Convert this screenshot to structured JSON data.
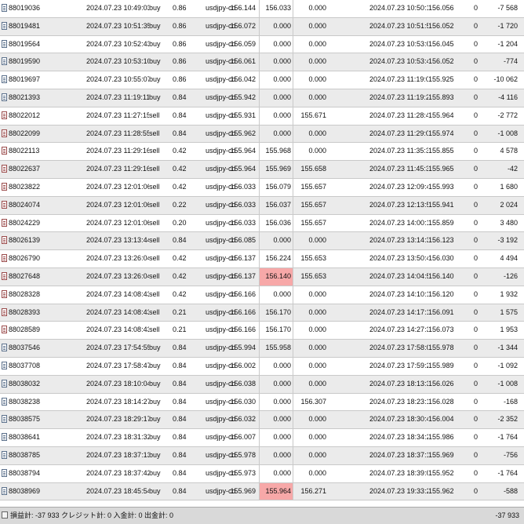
{
  "rows": [
    {
      "ticket": "88019036",
      "open_time": "2024.07.23 10:49:03",
      "type": "buy",
      "volume": "0.86",
      "symbol": "usdjpy-cd",
      "open_price": "156.144",
      "sl": "156.033",
      "tp": "0.000",
      "close_time": "2024.07.23 10:50:17",
      "close_price": "156.056",
      "commission": "0",
      "profit": "-7 568",
      "highlight_sl": false
    },
    {
      "ticket": "88019481",
      "open_time": "2024.07.23 10:51:35",
      "type": "buy",
      "volume": "0.86",
      "symbol": "usdjpy-cd",
      "open_price": "156.072",
      "sl": "0.000",
      "tp": "0.000",
      "close_time": "2024.07.23 10:51:50",
      "close_price": "156.052",
      "commission": "0",
      "profit": "-1 720",
      "highlight_sl": false
    },
    {
      "ticket": "88019564",
      "open_time": "2024.07.23 10:52:43",
      "type": "buy",
      "volume": "0.86",
      "symbol": "usdjpy-cd",
      "open_price": "156.059",
      "sl": "0.000",
      "tp": "0.000",
      "close_time": "2024.07.23 10:53:02",
      "close_price": "156.045",
      "commission": "0",
      "profit": "-1 204",
      "highlight_sl": false
    },
    {
      "ticket": "88019590",
      "open_time": "2024.07.23 10:53:10",
      "type": "buy",
      "volume": "0.86",
      "symbol": "usdjpy-cd",
      "open_price": "156.061",
      "sl": "0.000",
      "tp": "0.000",
      "close_time": "2024.07.23 10:53:45",
      "close_price": "156.052",
      "commission": "0",
      "profit": "-774",
      "highlight_sl": false
    },
    {
      "ticket": "88019697",
      "open_time": "2024.07.23 10:55:07",
      "type": "buy",
      "volume": "0.86",
      "symbol": "usdjpy-cd",
      "open_price": "156.042",
      "sl": "0.000",
      "tp": "0.000",
      "close_time": "2024.07.23 11:19:01",
      "close_price": "155.925",
      "commission": "0",
      "profit": "-10 062",
      "highlight_sl": false
    },
    {
      "ticket": "88021393",
      "open_time": "2024.07.23 11:19:11",
      "type": "buy",
      "volume": "0.84",
      "symbol": "usdjpy-cd",
      "open_price": "155.942",
      "sl": "0.000",
      "tp": "0.000",
      "close_time": "2024.07.23 11:19:27",
      "close_price": "155.893",
      "commission": "0",
      "profit": "-4 116",
      "highlight_sl": false
    },
    {
      "ticket": "88022012",
      "open_time": "2024.07.23 11:27:15",
      "type": "sell",
      "volume": "0.84",
      "symbol": "usdjpy-cd",
      "open_price": "155.931",
      "sl": "0.000",
      "tp": "155.671",
      "close_time": "2024.07.23 11:28:49",
      "close_price": "155.964",
      "commission": "0",
      "profit": "-2 772",
      "highlight_sl": false
    },
    {
      "ticket": "88022099",
      "open_time": "2024.07.23 11:28:55",
      "type": "sell",
      "volume": "0.84",
      "symbol": "usdjpy-cd",
      "open_price": "155.962",
      "sl": "0.000",
      "tp": "0.000",
      "close_time": "2024.07.23 11:29:09",
      "close_price": "155.974",
      "commission": "0",
      "profit": "-1 008",
      "highlight_sl": false
    },
    {
      "ticket": "88022113",
      "open_time": "2024.07.23 11:29:16",
      "type": "sell",
      "volume": "0.42",
      "symbol": "usdjpy-cd",
      "open_price": "155.964",
      "sl": "155.968",
      "tp": "0.000",
      "close_time": "2024.07.23 11:35:38",
      "close_price": "155.855",
      "commission": "0",
      "profit": "4 578",
      "highlight_sl": false
    },
    {
      "ticket": "88022637",
      "open_time": "2024.07.23 11:29:16",
      "type": "sell",
      "volume": "0.42",
      "symbol": "usdjpy-cd",
      "open_price": "155.964",
      "sl": "155.969",
      "tp": "155.658",
      "close_time": "2024.07.23 11:45:37",
      "close_price": "155.965",
      "commission": "0",
      "profit": "-42",
      "highlight_sl": false
    },
    {
      "ticket": "88023822",
      "open_time": "2024.07.23 12:01:06",
      "type": "sell",
      "volume": "0.42",
      "symbol": "usdjpy-cd",
      "open_price": "156.033",
      "sl": "156.079",
      "tp": "155.657",
      "close_time": "2024.07.23 12:09:46",
      "close_price": "155.993",
      "commission": "0",
      "profit": "1 680",
      "highlight_sl": false
    },
    {
      "ticket": "88024074",
      "open_time": "2024.07.23 12:01:06",
      "type": "sell",
      "volume": "0.22",
      "symbol": "usdjpy-cd",
      "open_price": "156.033",
      "sl": "156.037",
      "tp": "155.657",
      "close_time": "2024.07.23 12:13:52",
      "close_price": "155.941",
      "commission": "0",
      "profit": "2 024",
      "highlight_sl": false
    },
    {
      "ticket": "88024229",
      "open_time": "2024.07.23 12:01:06",
      "type": "sell",
      "volume": "0.20",
      "symbol": "usdjpy-cd",
      "open_price": "156.033",
      "sl": "156.036",
      "tp": "155.657",
      "close_time": "2024.07.23 14:00:12",
      "close_price": "155.859",
      "commission": "0",
      "profit": "3 480",
      "highlight_sl": false
    },
    {
      "ticket": "88026139",
      "open_time": "2024.07.23 13:13:44",
      "type": "sell",
      "volume": "0.84",
      "symbol": "usdjpy-cd",
      "open_price": "156.085",
      "sl": "0.000",
      "tp": "0.000",
      "close_time": "2024.07.23 13:14:33",
      "close_price": "156.123",
      "commission": "0",
      "profit": "-3 192",
      "highlight_sl": false
    },
    {
      "ticket": "88026790",
      "open_time": "2024.07.23 13:26:04",
      "type": "sell",
      "volume": "0.42",
      "symbol": "usdjpy-cd",
      "open_price": "156.137",
      "sl": "156.224",
      "tp": "155.653",
      "close_time": "2024.07.23 13:50:46",
      "close_price": "156.030",
      "commission": "0",
      "profit": "4 494",
      "highlight_sl": false
    },
    {
      "ticket": "88027648",
      "open_time": "2024.07.23 13:26:04",
      "type": "sell",
      "volume": "0.42",
      "symbol": "usdjpy-cd",
      "open_price": "156.137",
      "sl": "156.140",
      "tp": "155.653",
      "close_time": "2024.07.23 14:04:50",
      "close_price": "156.140",
      "commission": "0",
      "profit": "-126",
      "highlight_sl": true
    },
    {
      "ticket": "88028328",
      "open_time": "2024.07.23 14:08:43",
      "type": "sell",
      "volume": "0.42",
      "symbol": "usdjpy-cd",
      "open_price": "156.166",
      "sl": "0.000",
      "tp": "0.000",
      "close_time": "2024.07.23 14:10:17",
      "close_price": "156.120",
      "commission": "0",
      "profit": "1 932",
      "highlight_sl": false
    },
    {
      "ticket": "88028393",
      "open_time": "2024.07.23 14:08:43",
      "type": "sell",
      "volume": "0.21",
      "symbol": "usdjpy-cd",
      "open_price": "156.166",
      "sl": "156.170",
      "tp": "0.000",
      "close_time": "2024.07.23 14:17:13",
      "close_price": "156.091",
      "commission": "0",
      "profit": "1 575",
      "highlight_sl": false
    },
    {
      "ticket": "88028589",
      "open_time": "2024.07.23 14:08:43",
      "type": "sell",
      "volume": "0.21",
      "symbol": "usdjpy-cd",
      "open_price": "156.166",
      "sl": "156.170",
      "tp": "0.000",
      "close_time": "2024.07.23 14:27:36",
      "close_price": "156.073",
      "commission": "0",
      "profit": "1 953",
      "highlight_sl": false
    },
    {
      "ticket": "88037546",
      "open_time": "2024.07.23 17:54:55",
      "type": "buy",
      "volume": "0.84",
      "symbol": "usdjpy-cd",
      "open_price": "155.994",
      "sl": "155.958",
      "tp": "0.000",
      "close_time": "2024.07.23 17:58:08",
      "close_price": "155.978",
      "commission": "0",
      "profit": "-1 344",
      "highlight_sl": false
    },
    {
      "ticket": "88037708",
      "open_time": "2024.07.23 17:58:47",
      "type": "buy",
      "volume": "0.84",
      "symbol": "usdjpy-cd",
      "open_price": "156.002",
      "sl": "0.000",
      "tp": "0.000",
      "close_time": "2024.07.23 17:59:23",
      "close_price": "155.989",
      "commission": "0",
      "profit": "-1 092",
      "highlight_sl": false
    },
    {
      "ticket": "88038032",
      "open_time": "2024.07.23 18:10:04",
      "type": "buy",
      "volume": "0.84",
      "symbol": "usdjpy-cd",
      "open_price": "156.038",
      "sl": "0.000",
      "tp": "0.000",
      "close_time": "2024.07.23 18:13:34",
      "close_price": "156.026",
      "commission": "0",
      "profit": "-1 008",
      "highlight_sl": false
    },
    {
      "ticket": "88038238",
      "open_time": "2024.07.23 18:14:27",
      "type": "buy",
      "volume": "0.84",
      "symbol": "usdjpy-cd",
      "open_price": "156.030",
      "sl": "0.000",
      "tp": "156.307",
      "close_time": "2024.07.23 18:23:17",
      "close_price": "156.028",
      "commission": "0",
      "profit": "-168",
      "highlight_sl": false
    },
    {
      "ticket": "88038575",
      "open_time": "2024.07.23 18:29:17",
      "type": "buy",
      "volume": "0.84",
      "symbol": "usdjpy-cd",
      "open_price": "156.032",
      "sl": "0.000",
      "tp": "0.000",
      "close_time": "2024.07.23 18:30:44",
      "close_price": "156.004",
      "commission": "0",
      "profit": "-2 352",
      "highlight_sl": false
    },
    {
      "ticket": "88038641",
      "open_time": "2024.07.23 18:31:32",
      "type": "buy",
      "volume": "0.84",
      "symbol": "usdjpy-cd",
      "open_price": "156.007",
      "sl": "0.000",
      "tp": "0.000",
      "close_time": "2024.07.23 18:34:21",
      "close_price": "155.986",
      "commission": "0",
      "profit": "-1 764",
      "highlight_sl": false
    },
    {
      "ticket": "88038785",
      "open_time": "2024.07.23 18:37:13",
      "type": "buy",
      "volume": "0.84",
      "symbol": "usdjpy-cd",
      "open_price": "155.978",
      "sl": "0.000",
      "tp": "0.000",
      "close_time": "2024.07.23 18:37:18",
      "close_price": "155.969",
      "commission": "0",
      "profit": "-756",
      "highlight_sl": false
    },
    {
      "ticket": "88038794",
      "open_time": "2024.07.23 18:37:42",
      "type": "buy",
      "volume": "0.84",
      "symbol": "usdjpy-cd",
      "open_price": "155.973",
      "sl": "0.000",
      "tp": "0.000",
      "close_time": "2024.07.23 18:39:02",
      "close_price": "155.952",
      "commission": "0",
      "profit": "-1 764",
      "highlight_sl": false
    },
    {
      "ticket": "88038969",
      "open_time": "2024.07.23 18:45:54",
      "type": "buy",
      "volume": "0.84",
      "symbol": "usdjpy-cd",
      "open_price": "155.969",
      "sl": "155.964",
      "tp": "156.271",
      "close_time": "2024.07.23 19:33:20",
      "close_price": "155.962",
      "commission": "0",
      "profit": "-588",
      "highlight_sl": true
    }
  ],
  "footer": {
    "summary": "損益計: -37 933  クレジット計: 0  入金計: 0  出金計: 0",
    "total": "-37 933"
  }
}
